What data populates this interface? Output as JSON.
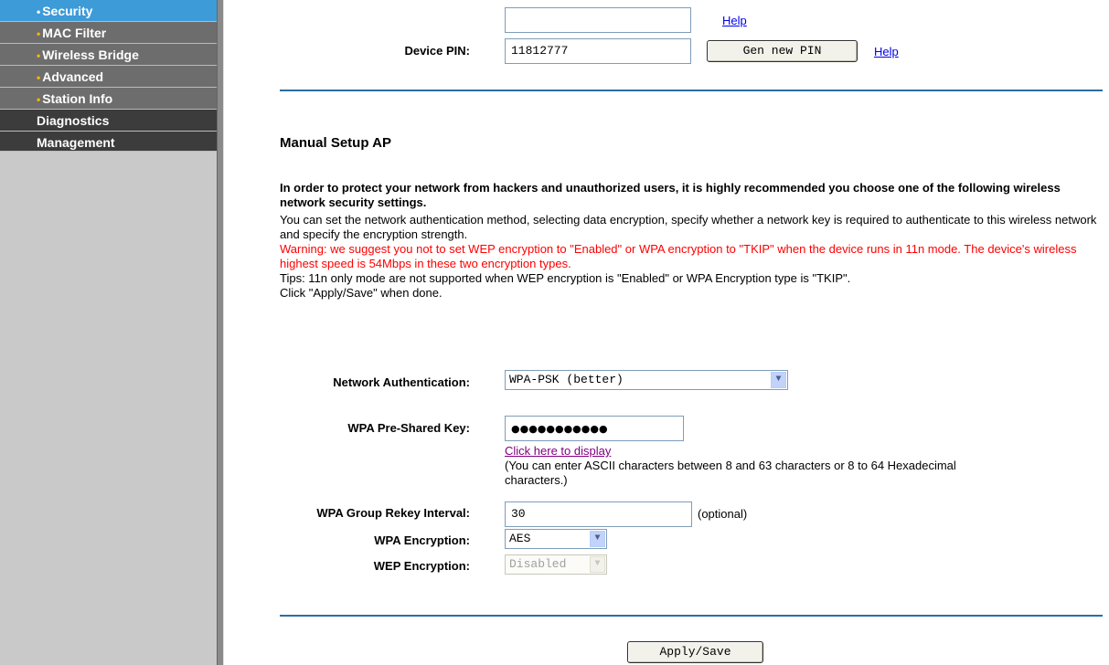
{
  "sidebar": {
    "sub_items": [
      {
        "label": "Security"
      },
      {
        "label": "MAC Filter"
      },
      {
        "label": "Wireless Bridge"
      },
      {
        "label": "Advanced"
      },
      {
        "label": "Station Info"
      }
    ],
    "top_items": [
      {
        "label": "Diagnostics"
      },
      {
        "label": "Management"
      }
    ]
  },
  "wps": {
    "top_help": "Help",
    "device_pin_label": "Device PIN:",
    "device_pin_value": "11812777",
    "gen_pin_button": "Gen new PIN",
    "pin_help": "Help"
  },
  "manual": {
    "title": "Manual Setup AP",
    "intro_bold": "In order to protect your network from hackers and unauthorized users, it is highly recommended you choose one of the following wireless network security settings.",
    "intro_text": "You can set the network authentication method, selecting data encryption, specify whether a network key is required to authenticate to this wireless network and specify the encryption strength.",
    "warning": "Warning: we suggest you not to set WEP encryption to \"Enabled\" or WPA encryption to \"TKIP\" when the device runs in 11n mode. The device's wireless highest speed is 54Mbps in these two encryption types.",
    "tips": "Tips: 11n only mode are not supported when WEP encryption is \"Enabled\" or WPA Encryption type is \"TKIP\".",
    "click_apply": "Click \"Apply/Save\" when done."
  },
  "form": {
    "network_auth_label": "Network Authentication:",
    "network_auth_value": "WPA-PSK (better)",
    "psk_label": "WPA Pre-Shared Key:",
    "psk_value": "●●●●●●●●●●●",
    "display_link": "Click here to display",
    "psk_hint": "(You can enter ASCII characters between 8 and 63 characters or 8 to 64 Hexadecimal characters.)",
    "rekey_label": "WPA Group Rekey Interval:",
    "rekey_value": "30",
    "rekey_note": "(optional)",
    "wpa_enc_label": "WPA Encryption:",
    "wpa_enc_value": "AES",
    "wep_enc_label": "WEP Encryption:",
    "wep_enc_value": "Disabled",
    "apply_button": "Apply/Save"
  },
  "colors": {
    "active_nav": "#3d9bd7",
    "sub_nav": "#6d6d6d",
    "top_nav": "#3c3c3c",
    "divider": "#2b6ea3",
    "warning": "#ff0000",
    "link": "#0000ee"
  }
}
